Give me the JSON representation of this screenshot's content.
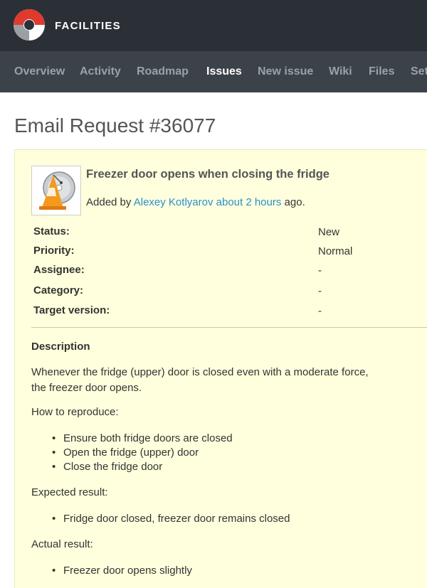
{
  "header": {
    "app_name": "FACILITIES"
  },
  "nav": {
    "items": [
      {
        "label": "Overview"
      },
      {
        "label": "Activity"
      },
      {
        "label": "Roadmap"
      },
      {
        "label": "Issues",
        "active": true
      },
      {
        "label": "New issue"
      },
      {
        "label": "Wiki"
      },
      {
        "label": "Files"
      },
      {
        "label": "Settings"
      }
    ]
  },
  "page": {
    "title": "Email Request #36077"
  },
  "issue": {
    "subject": "Freezer door opens when closing the fridge",
    "added_by_prefix": "Added by",
    "author": "Alexey Kotlyarov",
    "time_ago": "about 2 hours",
    "suffix": "ago.",
    "attributes": [
      {
        "label": "Status:",
        "value": "New"
      },
      {
        "label": "Priority:",
        "value": "Normal"
      },
      {
        "label": "Assignee:",
        "value": "-"
      },
      {
        "label": "Category:",
        "value": "-"
      },
      {
        "label": "Target version:",
        "value": "-"
      }
    ],
    "description": {
      "heading": "Description",
      "intro_line1": "Whenever the fridge (upper) door is closed even with a moderate force,",
      "intro_line2": "the freezer door opens.",
      "how_to_reproduce": "How to reproduce:",
      "steps": [
        "Ensure both fridge doors are closed",
        "Open the fridge (upper) door",
        "Close the fridge door"
      ],
      "expected_heading": "Expected result:",
      "expected": [
        "Fridge door closed, freezer door remains closed"
      ],
      "actual_heading": "Actual result:",
      "actual": [
        "Freezer door opens slightly"
      ]
    }
  },
  "colors": {
    "topbar": "#2b3036",
    "nav": "#3c4249",
    "issue_background": "#ffffdd",
    "link": "#2a8fd0"
  },
  "icons": {
    "logo": "facilities-logo-icon",
    "avatar": "vlc-cone-avatar"
  }
}
